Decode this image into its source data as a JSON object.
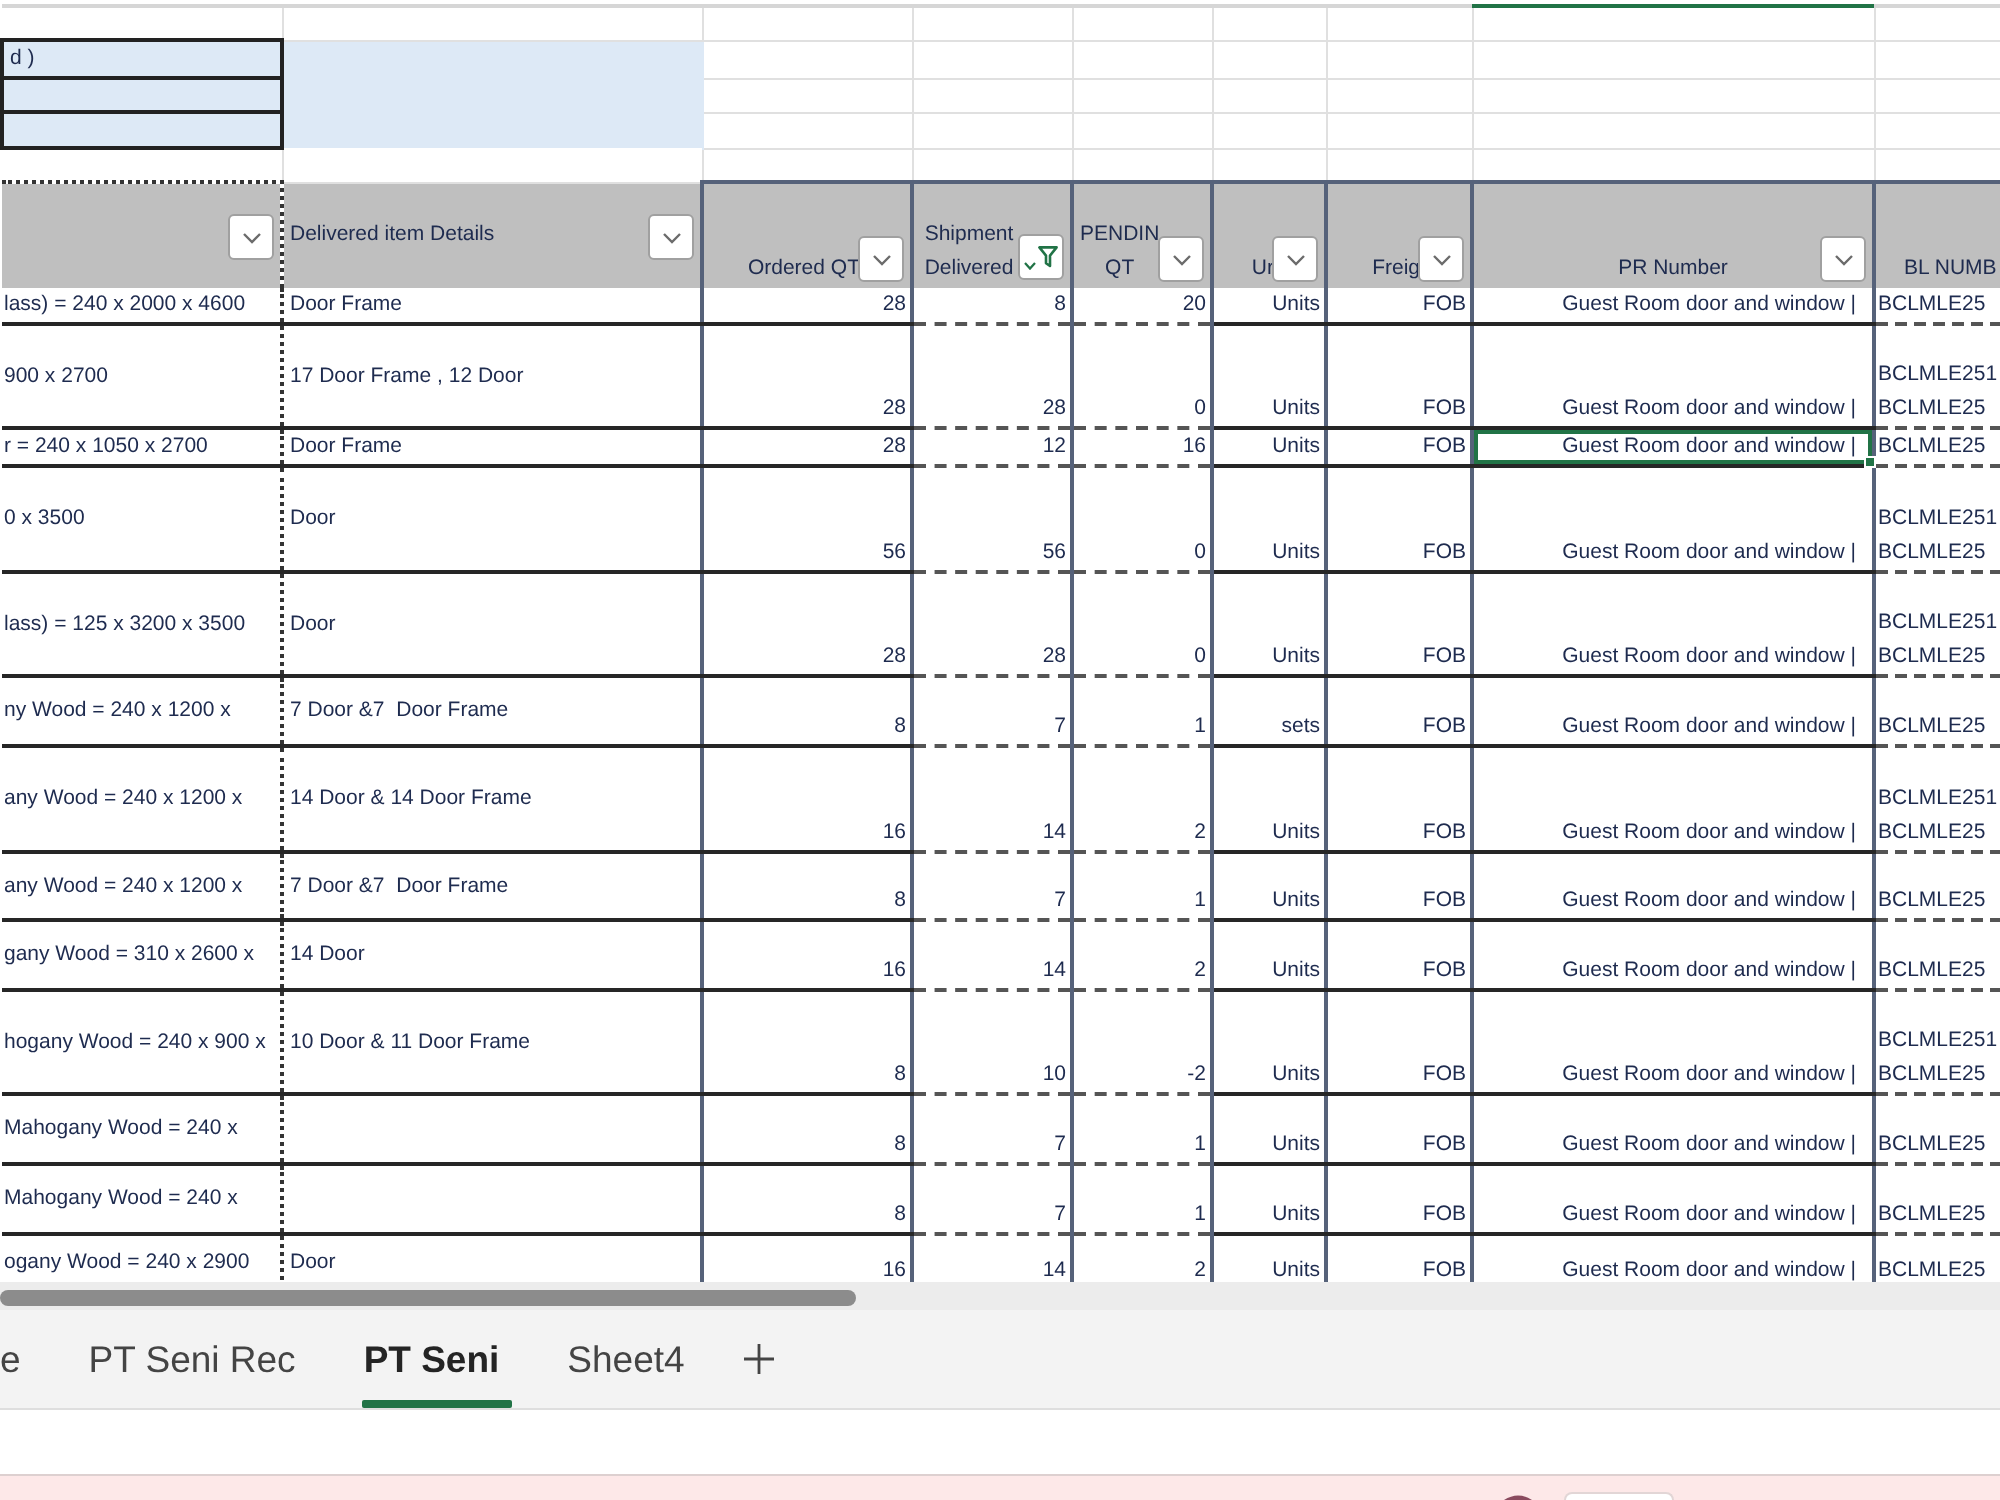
{
  "info_block": {
    "title": "d )"
  },
  "table": {
    "columns": [
      {
        "filtered": false
      },
      {
        "header": [
          "Delivered item Details"
        ],
        "filtered": false
      },
      {
        "header": [
          "Ordered QT"
        ],
        "filtered": false
      },
      {
        "header": [
          "Shipment",
          "Delivered"
        ],
        "filtered": true
      },
      {
        "header": [
          "PENDIN",
          "QT"
        ],
        "filtered": false
      },
      {
        "header": [
          "Ur"
        ],
        "filtered": false
      },
      {
        "header": [
          "Freig"
        ],
        "filtered": false
      },
      {
        "header": [
          "PR Number"
        ],
        "filtered": false
      },
      {
        "header": [
          "BL NUMB"
        ]
      }
    ],
    "rows": [
      {
        "column_1": "lass) = 240 x 2000 x 4600",
        "delivered_details": "Door Frame",
        "ordered_qty": "28",
        "shipment_delivered": "8",
        "pending_qty": "20",
        "unit": "Units",
        "freight": "FOB",
        "pr_number": {
          "text": "Guest Room door and window |",
          "selected": false
        },
        "bl_number": [
          "BCLMLE25"
        ]
      },
      {
        "column_1": "900 x 2700",
        "delivered_details": "17 Door Frame , 12 Door",
        "ordered_qty": "28",
        "shipment_delivered": "28",
        "pending_qty": "0",
        "unit": "Units",
        "freight": "FOB",
        "pr_number": {
          "text": "Guest Room door and window |",
          "selected": false
        },
        "bl_number": [
          "BCLMLE251",
          "BCLMLE25"
        ]
      },
      {
        "column_1": "r = 240 x 1050 x 2700",
        "delivered_details": "Door Frame",
        "ordered_qty": "28",
        "shipment_delivered": "12",
        "pending_qty": "16",
        "unit": "Units",
        "freight": "FOB",
        "pr_number": {
          "text": "Guest Room door and window |",
          "selected": true
        },
        "bl_number": [
          "BCLMLE25"
        ]
      },
      {
        "column_1": "0 x 3500",
        "delivered_details": "Door",
        "ordered_qty": "56",
        "shipment_delivered": "56",
        "pending_qty": "0",
        "unit": "Units",
        "freight": "FOB",
        "pr_number": {
          "text": "Guest Room door and window |",
          "selected": false
        },
        "bl_number": [
          "BCLMLE251",
          "BCLMLE25"
        ]
      },
      {
        "column_1": "lass) = 125 x 3200 x 3500",
        "delivered_details": "Door",
        "ordered_qty": "28",
        "shipment_delivered": "28",
        "pending_qty": "0",
        "unit": "Units",
        "freight": "FOB",
        "pr_number": {
          "text": "Guest Room door and window |",
          "selected": false
        },
        "bl_number": [
          "BCLMLE251",
          "BCLMLE25"
        ]
      },
      {
        "column_1": "ny Wood = 240 x 1200 x",
        "delivered_details": "7 Door &7  Door Frame",
        "ordered_qty": "8",
        "shipment_delivered": "7",
        "pending_qty": "1",
        "unit": "sets",
        "freight": "FOB",
        "pr_number": {
          "text": "Guest Room door and window |",
          "selected": false
        },
        "bl_number": [
          "BCLMLE25"
        ]
      },
      {
        "column_1": "any Wood = 240 x 1200 x",
        "delivered_details": "14 Door & 14 Door Frame",
        "ordered_qty": "16",
        "shipment_delivered": "14",
        "pending_qty": "2",
        "unit": "Units",
        "freight": "FOB",
        "pr_number": {
          "text": "Guest Room door and window |",
          "selected": false
        },
        "bl_number": [
          "BCLMLE251",
          "BCLMLE25"
        ]
      },
      {
        "column_1": "any Wood = 240 x 1200 x",
        "delivered_details": "7 Door &7  Door Frame",
        "ordered_qty": "8",
        "shipment_delivered": "7",
        "pending_qty": "1",
        "unit": "Units",
        "freight": "FOB",
        "pr_number": {
          "text": "Guest Room door and window |",
          "selected": false
        },
        "bl_number": [
          "BCLMLE25"
        ]
      },
      {
        "column_1": "gany Wood = 310 x 2600 x",
        "delivered_details": "14 Door",
        "ordered_qty": "16",
        "shipment_delivered": "14",
        "pending_qty": "2",
        "unit": "Units",
        "freight": "FOB",
        "pr_number": {
          "text": "Guest Room door and window |",
          "selected": false
        },
        "bl_number": [
          "BCLMLE25"
        ]
      },
      {
        "column_1": "hogany Wood = 240 x 900 x",
        "delivered_details": "10 Door & 11 Door Frame",
        "ordered_qty": "8",
        "shipment_delivered": "10",
        "pending_qty": "-2",
        "unit": "Units",
        "freight": "FOB",
        "pr_number": {
          "text": "Guest Room door and window |",
          "selected": false
        },
        "bl_number": [
          "BCLMLE251",
          "BCLMLE25"
        ]
      },
      {
        "column_1": "Mahogany Wood = 240 x",
        "ordered_qty": "8",
        "shipment_delivered": "7",
        "pending_qty": "1",
        "unit": "Units",
        "freight": "FOB",
        "pr_number": {
          "text": "Guest Room door and window |",
          "selected": false
        },
        "bl_number": [
          "BCLMLE25"
        ]
      },
      {
        "column_1": "Mahogany Wood = 240 x",
        "ordered_qty": "8",
        "shipment_delivered": "7",
        "pending_qty": "1",
        "unit": "Units",
        "freight": "FOB",
        "pr_number": {
          "text": "Guest Room door and window |",
          "selected": false
        },
        "bl_number": [
          "BCLMLE25"
        ]
      },
      {
        "column_1": "ogany Wood = 240 x 2900",
        "delivered_details": "Door",
        "ordered_qty": "16",
        "shipment_delivered": "14",
        "pending_qty": "2",
        "unit": "Units",
        "freight": "FOB",
        "pr_number": {
          "text": "Guest Room door and window |",
          "selected": false
        },
        "bl_number": [
          "BCLMLE25"
        ]
      }
    ]
  },
  "sheet_tabs": [
    {
      "label": "e",
      "selected": false
    },
    {
      "label": "PT Seni Rec",
      "selected": false
    },
    {
      "label": "PT Seni",
      "selected": true
    },
    {
      "label": "Sheet4",
      "selected": false
    }
  ]
}
